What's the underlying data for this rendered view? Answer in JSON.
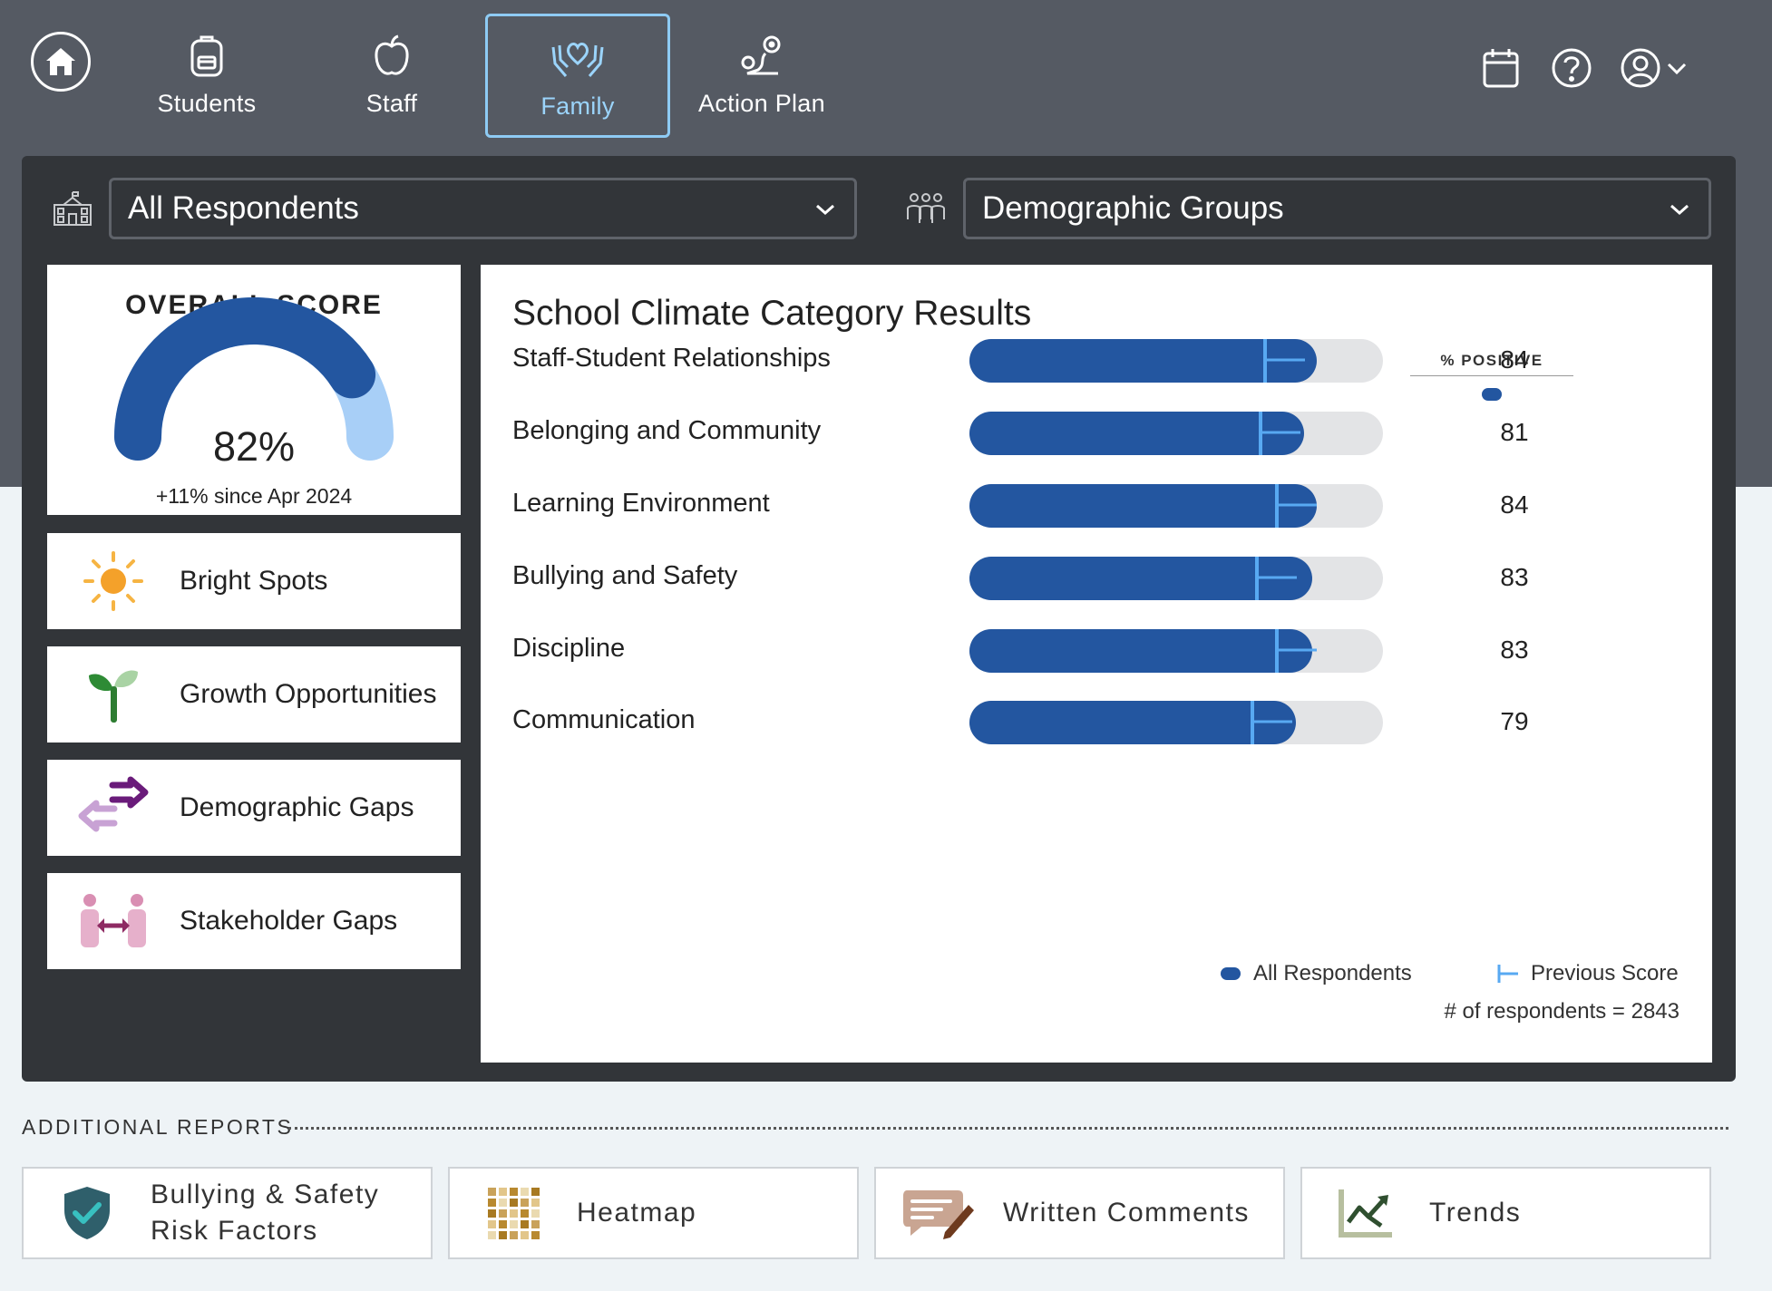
{
  "nav": {
    "home_icon": "home-icon",
    "tabs": [
      {
        "label": "Students",
        "icon": "backpack-icon"
      },
      {
        "label": "Staff",
        "icon": "apple-icon"
      },
      {
        "label": "Family",
        "icon": "heart-hands-icon",
        "active": true
      },
      {
        "label": "Action Plan",
        "icon": "route-icon"
      }
    ],
    "right_icons": [
      "calendar-icon",
      "help-icon",
      "user-icon",
      "chevron-down-icon"
    ]
  },
  "filters": {
    "respondents": {
      "value": "All Respondents",
      "icon": "school-icon"
    },
    "groups": {
      "value": "Demographic Groups",
      "icon": "people-group-icon"
    }
  },
  "overall": {
    "title": "OVERALL SCORE",
    "value": "82%",
    "value_fraction": 0.82,
    "since": "+11% since Apr 2024",
    "colors": {
      "primary": "#2356a0",
      "secondary": "#a8cff7"
    }
  },
  "side_cards": [
    {
      "label": "Bright Spots",
      "icon": "sun-icon"
    },
    {
      "label": "Growth Opportunities",
      "icon": "sprout-icon"
    },
    {
      "label": "Demographic Gaps",
      "icon": "swap-arrows-icon"
    },
    {
      "label": "Stakeholder Gaps",
      "icon": "people-exchange-icon"
    }
  ],
  "results": {
    "title": "School Climate Category Results",
    "column_header": "% POSITIVE",
    "legend": {
      "current": "All Respondents",
      "previous": "Previous Score"
    },
    "respondents": "# of respondents = 2843",
    "colors": {
      "bar": "#2356a0",
      "track": "#e3e4e6",
      "previous_marker": "#58a9f2"
    }
  },
  "chart_data": {
    "type": "bar",
    "orientation": "horizontal",
    "categories": [
      "Staff-Student Relationships",
      "Belonging and Community",
      "Learning Environment",
      "Bullying and Safety",
      "Discipline",
      "Communication"
    ],
    "series": [
      {
        "name": "All Respondents",
        "values": [
          84,
          81,
          84,
          83,
          83,
          79
        ]
      },
      {
        "name": "Previous Score",
        "values": [
          71,
          70,
          74,
          69,
          74,
          68
        ]
      }
    ],
    "labels": [
      "84",
      "81",
      "84",
      "83",
      "83",
      "79"
    ],
    "xlim": [
      0,
      100
    ]
  },
  "reports": {
    "title": "ADDITIONAL REPORTS",
    "items": [
      {
        "label_line1": "Bullying & Safety",
        "label_line2": "Risk Factors",
        "icon": "shield-check-icon"
      },
      {
        "label_line1": "Heatmap",
        "label_line2": "",
        "icon": "grid-icon"
      },
      {
        "label_line1": "Written Comments",
        "label_line2": "",
        "icon": "comment-pen-icon"
      },
      {
        "label_line1": "Trends",
        "label_line2": "",
        "icon": "trend-chart-icon"
      }
    ]
  }
}
